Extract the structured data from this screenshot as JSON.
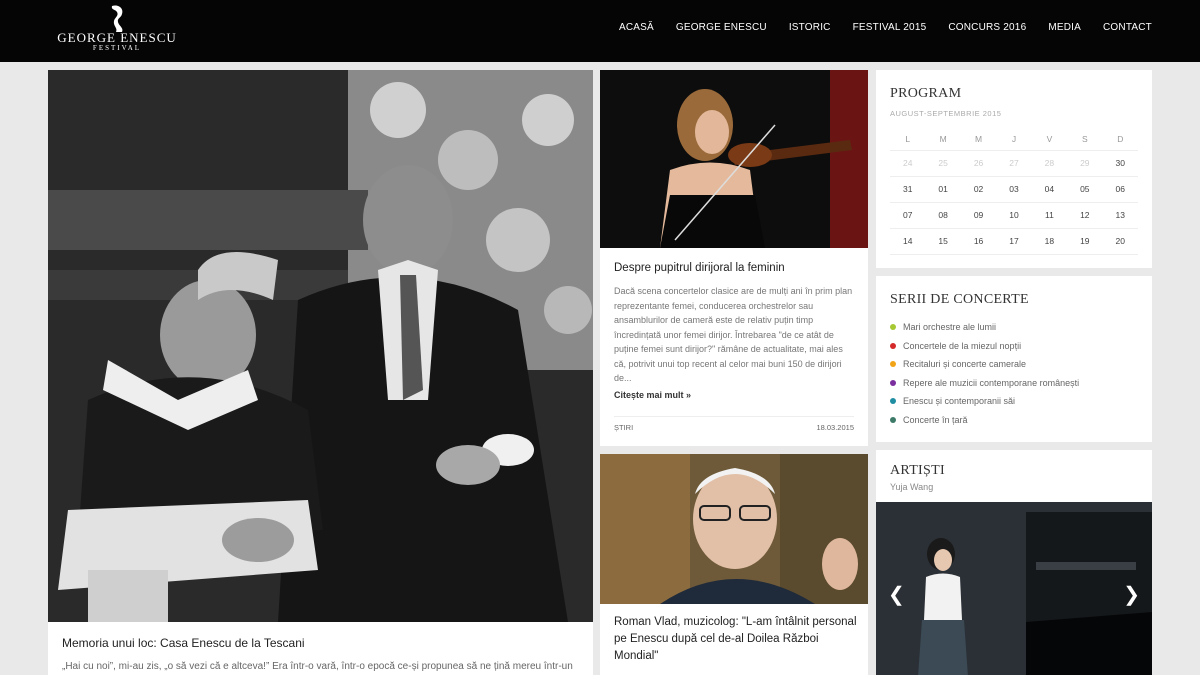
{
  "header": {
    "logo_name": "GEORGE ENESCU",
    "logo_sub": "FESTIVAL",
    "nav": [
      "ACASĂ",
      "GEORGE ENESCU",
      "ISTORIC",
      "FESTIVAL 2015",
      "CONCURS 2016",
      "MEDIA",
      "CONTACT"
    ]
  },
  "feature": {
    "title": "Memoria unui loc: Casa Enescu de la Tescani",
    "excerpt": "„Hai cu noi”, mi-au zis, „o să vezi că e altceva!” Era într-o vară, într-o epocă ce-și propunea să ne țină mereu într-un"
  },
  "cards": [
    {
      "title": "Despre pupitrul dirijoral la feminin",
      "body": "Dacă scena concertelor clasice are de mulți ani în prim plan reprezentante femei, conducerea orchestrelor sau ansamblurilor de cameră este de relativ puțin timp încredințată unor femei dirijor. Întrebarea \"de ce atât de puține femei sunt dirijor?\" rămâne de actualitate, mai ales că, potrivit unui top recent al celor mai buni 150 de dirijori de...",
      "read_more": "Citește mai mult »",
      "category": "ȘTIRI",
      "date": "18.03.2015"
    },
    {
      "title": "Roman Vlad, muzicolog: \"L-am întâlnit personal pe Enescu după cel de-al Doilea Război Mondial\""
    }
  ],
  "program": {
    "title": "PROGRAM",
    "month": "AUGUST-SEPTEMBRIE 2015",
    "weekdays": [
      "L",
      "M",
      "M",
      "J",
      "V",
      "S",
      "D"
    ],
    "rows": [
      [
        "24",
        "25",
        "26",
        "27",
        "28",
        "29",
        "30"
      ],
      [
        "31",
        "01",
        "02",
        "03",
        "04",
        "05",
        "06"
      ],
      [
        "07",
        "08",
        "09",
        "10",
        "11",
        "12",
        "13"
      ],
      [
        "14",
        "15",
        "16",
        "17",
        "18",
        "19",
        "20"
      ]
    ]
  },
  "series": {
    "title": "SERII DE CONCERTE",
    "items": [
      {
        "label": "Mari orchestre ale lumii",
        "color": "#a6c832"
      },
      {
        "label": "Concertele de la miezul nopții",
        "color": "#d42a2a"
      },
      {
        "label": "Recitaluri și concerte camerale",
        "color": "#f2a418"
      },
      {
        "label": "Repere ale muzicii contemporane românești",
        "color": "#7b2f9e"
      },
      {
        "label": "Enescu și contemporanii săi",
        "color": "#1f8ea3"
      },
      {
        "label": "Concerte în țară",
        "color": "#3d7a68"
      }
    ]
  },
  "artists": {
    "title": "ARTIȘTI",
    "name": "Yuja Wang"
  }
}
